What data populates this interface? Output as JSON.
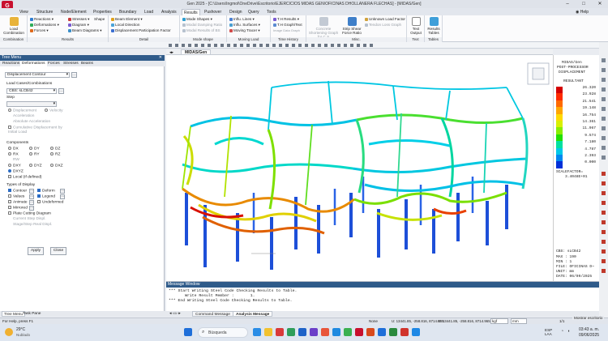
{
  "window": {
    "title": "Gen 2025 - [C:\\Users\\Ingmol\\OneDrive\\Escritorio\\EJERCICIOS MIDAS GEN\\OFICINAS DHOLLANERA FLECHAS] - [MIDAS/Gen]",
    "logo": "G",
    "help_label": "Help"
  },
  "ribbon": {
    "tabs": [
      "View",
      "Structure",
      "Node/Element",
      "Properties",
      "Boundary",
      "Load",
      "Analysis",
      "Results",
      "Pushover",
      "Design",
      "Query",
      "Tools"
    ],
    "active_tab": "Results",
    "groups": {
      "combination": {
        "label": "Combination",
        "button": "Load Combination"
      },
      "results": {
        "label": "Results",
        "items": [
          "Reactions",
          "Deformations",
          "Forces",
          "Stresses",
          "Diagram",
          "Beam Diagrams",
          "Beam Element",
          "Local Direction",
          "Displacement Participation Factor",
          "Shape"
        ]
      },
      "detail": {
        "label": "Detail"
      },
      "mode_shape": {
        "label": "Mode shape",
        "items": [
          "Mode Shapes",
          "Modal Damping Ratio",
          "Modal Results of BS"
        ]
      },
      "moving_load": {
        "label": "Moving Load",
        "items": [
          "Influ. Lines",
          "Influ. Surfaces",
          "Moving Tracer",
          "Image Data Graph"
        ]
      },
      "time_history": {
        "label": "Time History",
        "items": [
          "T.H Results",
          "T.H Graph/Text"
        ]
      },
      "misc": {
        "label": "Misc.",
        "items": [
          "Concrete Shortening Graph for C.S",
          "Strip Shear Force Ratio",
          "Unknown Load Factor",
          "Tendon Loss Graph"
        ]
      },
      "text": {
        "label": "Text",
        "button": "Text Output"
      },
      "tables": {
        "label": "Tables",
        "button": "Results Tables"
      }
    }
  },
  "left_panel": {
    "title": "Tree Menu",
    "tabs": [
      "Reactions",
      "Deformations",
      "Forces",
      "Stresses",
      "Beams"
    ],
    "active_tab": "Deformations",
    "contour_type": "Displacement Contour",
    "lc_label": "Load Cases/Combinations",
    "lc_value": "CBS: sLCB42",
    "step_label": "Step",
    "options": [
      "Displacement",
      "Velocity",
      "Acceleration",
      "Absolute Acceleration",
      "Cumulative Displacement by Initial Load"
    ],
    "components_label": "Components",
    "components": [
      "DX",
      "DY",
      "DZ",
      "RX",
      "RY",
      "RZ",
      "RW",
      "DXY",
      "DYZ",
      "DXZ",
      "DXYZ",
      "Local (if defined)"
    ],
    "active_component": "DXYZ",
    "display_label": "Types of Display",
    "display": [
      "Contour",
      "Deform",
      "Values",
      "Legend",
      "Animate",
      "Undeformed",
      "Mirrored",
      "Plate Cutting Diagram",
      "Current Step Displ.",
      "Stage/Step Real Displ."
    ],
    "apply": "Apply",
    "close": "Close"
  },
  "bottom_tabs": [
    "Tree Menu",
    "Task Pane"
  ],
  "viewport": {
    "tab": "MIDAS/Gen"
  },
  "legend": {
    "program": "MIDAS/Gen",
    "header": "POST-PROCESSOR",
    "type": "DISPLACEMENT",
    "sub": "RESULTANT",
    "values": [
      "26.320",
      "23.928",
      "21.541",
      "19.148",
      "16.754",
      "14.361",
      "11.967",
      "9.574",
      "7.180",
      "4.787",
      "2.393",
      "0.000"
    ],
    "colors": [
      "#d40000",
      "#ff2a00",
      "#ff6a00",
      "#ffa600",
      "#ffd900",
      "#d8f000",
      "#88ee00",
      "#22e000",
      "#00e0a0",
      "#00c8e8",
      "#0088f0",
      "#0030d8"
    ],
    "scale_label": "SCALEFACTOR=",
    "scale_value": "3.4048E+01",
    "footer": [
      "CBS: sLCB42",
      "MAX : 190",
      "MIN : 1",
      "FILE: OFICINAS D~",
      "UNIT: mm",
      "DATE: 06/09/2025"
    ]
  },
  "message": {
    "title": "Message Window",
    "lines": [
      "*** Start Writing Steel Code Checking Results to Table.",
      "       Write Result Member :       1.",
      "*** End Writing Steel Code Checking Results to Table."
    ],
    "tabs": [
      "Command Message",
      "Analysis Message"
    ]
  },
  "status": {
    "left": "For Help, press F1",
    "node": "None",
    "coords1": "U: 13441.85, -258.816, 8714.965",
    "coords2": "G: 13441.85, -258.816, 8714.965",
    "unit_force": "kgf",
    "unit_len": "mm",
    "page": "1/1"
  },
  "taskbar": {
    "weather_temp": "29°C",
    "weather_desc": "Nublado",
    "search": "Búsqueda",
    "lang": "ESP\nLAA",
    "time": "03:43 a. m.",
    "date": "09/06/2025",
    "show_desktop": "Mostrar escritorio"
  }
}
